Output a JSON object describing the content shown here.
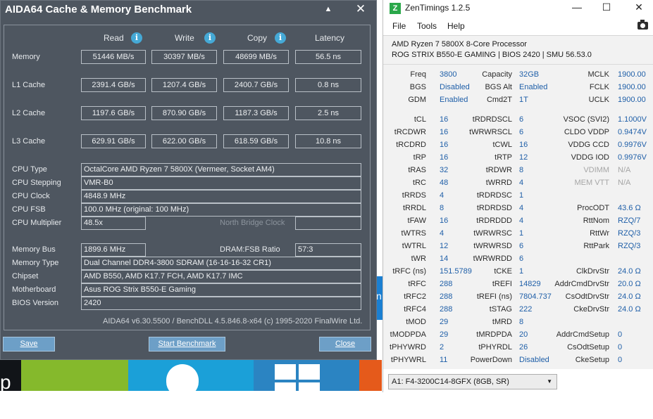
{
  "aida": {
    "title": "AIDA64 Cache & Memory Benchmark",
    "minimize": "▲",
    "close": "✕",
    "columns": [
      "Read",
      "Write",
      "Copy",
      "Latency"
    ],
    "info_glyph": "i",
    "bench_rows": [
      {
        "label": "Memory",
        "read": "51446 MB/s",
        "write": "30397 MB/s",
        "copy": "48699 MB/s",
        "latency": "56.5 ns"
      },
      {
        "label": "L1 Cache",
        "read": "2391.4 GB/s",
        "write": "1207.4 GB/s",
        "copy": "2400.7 GB/s",
        "latency": "0.8 ns"
      },
      {
        "label": "L2 Cache",
        "read": "1197.6 GB/s",
        "write": "870.90 GB/s",
        "copy": "1187.3 GB/s",
        "latency": "2.5 ns"
      },
      {
        "label": "L3 Cache",
        "read": "629.91 GB/s",
        "write": "622.00 GB/s",
        "copy": "618.59 GB/s",
        "latency": "10.8 ns"
      }
    ],
    "cpu": {
      "type_label": "CPU Type",
      "type": "OctalCore AMD Ryzen 7 5800X  (Vermeer, Socket AM4)",
      "stepping_label": "CPU Stepping",
      "stepping": "VMR-B0",
      "clock_label": "CPU Clock",
      "clock": "4848.9 MHz",
      "fsb_label": "CPU FSB",
      "fsb": "100.0 MHz  (original: 100 MHz)",
      "mult_label": "CPU Multiplier",
      "mult": "48.5x",
      "nb_label": "North Bridge Clock",
      "nb": ""
    },
    "mem": {
      "bus_label": "Memory Bus",
      "bus": "1899.6 MHz",
      "ratio_label": "DRAM:FSB Ratio",
      "ratio": "57:3",
      "type_label": "Memory Type",
      "type": "Dual Channel DDR4-3800 SDRAM  (16-16-16-32 CR1)",
      "chipset_label": "Chipset",
      "chipset": "AMD B550, AMD K17.7 FCH, AMD K17.7 IMC",
      "mobo_label": "Motherboard",
      "mobo": "Asus ROG Strix B550-E Gaming",
      "bios_label": "BIOS Version",
      "bios": "2420"
    },
    "footer": "AIDA64 v6.30.5500 / BenchDLL 4.5.846.8-x64  (c) 1995-2020 FinalWire Ltd.",
    "buttons": {
      "save": "Save",
      "start": "Start Benchmark",
      "close": "Close"
    }
  },
  "zen": {
    "logo": "Z",
    "title": "ZenTimings 1.2.5",
    "ctrl": {
      "min": "—",
      "max": "☐",
      "close": "✕"
    },
    "menu": [
      "File",
      "Tools",
      "Help"
    ],
    "cpu_name": "AMD Ryzen 7 5800X 8-Core Processor",
    "board": "ROG STRIX B550-E GAMING | BIOS 2420 | SMU 56.53.0",
    "top": [
      [
        [
          "Freq",
          "3800"
        ],
        [
          "Capacity",
          "32GB"
        ],
        [
          "MCLK",
          "1900.00"
        ]
      ],
      [
        [
          "BGS",
          "Disabled"
        ],
        [
          "BGS Alt",
          "Enabled"
        ],
        [
          "FCLK",
          "1900.00"
        ]
      ],
      [
        [
          "GDM",
          "Enabled"
        ],
        [
          "Cmd2T",
          "1T"
        ],
        [
          "UCLK",
          "1900.00"
        ]
      ]
    ],
    "timings": [
      [
        [
          "tCL",
          "16"
        ],
        [
          "tRDRDSCL",
          "6"
        ],
        [
          "VSOC (SVI2)",
          "1.1000V"
        ]
      ],
      [
        [
          "tRCDWR",
          "16"
        ],
        [
          "tWRWRSCL",
          "6"
        ],
        [
          "CLDO VDDP",
          "0.9474V"
        ]
      ],
      [
        [
          "tRCDRD",
          "16"
        ],
        [
          "tCWL",
          "16"
        ],
        [
          "VDDG CCD",
          "0.9976V"
        ]
      ],
      [
        [
          "tRP",
          "16"
        ],
        [
          "tRTP",
          "12"
        ],
        [
          "VDDG IOD",
          "0.9976V"
        ]
      ],
      [
        [
          "tRAS",
          "32"
        ],
        [
          "tRDWR",
          "8"
        ],
        [
          "VDIMM",
          "N/A"
        ]
      ],
      [
        [
          "tRC",
          "48"
        ],
        [
          "tWRRD",
          "4"
        ],
        [
          "MEM VTT",
          "N/A"
        ]
      ],
      [
        [
          "tRRDS",
          "4"
        ],
        [
          "tRDRDSC",
          "1"
        ],
        [
          "",
          ""
        ]
      ],
      [
        [
          "tRRDL",
          "8"
        ],
        [
          "tRDRDSD",
          "4"
        ],
        [
          "ProcODT",
          "43.6 Ω"
        ]
      ],
      [
        [
          "tFAW",
          "16"
        ],
        [
          "tRDRDDD",
          "4"
        ],
        [
          "RttNom",
          "RZQ/7"
        ]
      ],
      [
        [
          "tWTRS",
          "4"
        ],
        [
          "tWRWRSC",
          "1"
        ],
        [
          "RttWr",
          "RZQ/3"
        ]
      ],
      [
        [
          "tWTRL",
          "12"
        ],
        [
          "tWRWRSD",
          "6"
        ],
        [
          "RttPark",
          "RZQ/3"
        ]
      ],
      [
        [
          "tWR",
          "14"
        ],
        [
          "tWRWRDD",
          "6"
        ],
        [
          "",
          ""
        ]
      ],
      [
        [
          "tRFC (ns)",
          "151.5789"
        ],
        [
          "tCKE",
          "1"
        ],
        [
          "ClkDrvStr",
          "24.0 Ω"
        ]
      ],
      [
        [
          "tRFC",
          "288"
        ],
        [
          "tREFI",
          "14829"
        ],
        [
          "AddrCmdDrvStr",
          "20.0 Ω"
        ]
      ],
      [
        [
          "tRFC2",
          "288"
        ],
        [
          "tREFI (ns)",
          "7804.737"
        ],
        [
          "CsOdtDrvStr",
          "24.0 Ω"
        ]
      ],
      [
        [
          "tRFC4",
          "288"
        ],
        [
          "tSTAG",
          "222"
        ],
        [
          "CkeDrvStr",
          "24.0 Ω"
        ]
      ],
      [
        [
          "tMOD",
          "29"
        ],
        [
          "tMRD",
          "8"
        ],
        [
          "",
          ""
        ]
      ],
      [
        [
          "tMODPDA",
          "29"
        ],
        [
          "tMRDPDA",
          "20"
        ],
        [
          "AddrCmdSetup",
          "0"
        ]
      ],
      [
        [
          "tPHYWRD",
          "2"
        ],
        [
          "tPHYRDL",
          "26"
        ],
        [
          "CsOdtSetup",
          "0"
        ]
      ],
      [
        [
          "tPHYWRL",
          "11"
        ],
        [
          "PowerDown",
          "Disabled"
        ],
        [
          "CkeSetup",
          "0"
        ]
      ]
    ],
    "module_select": "A1: F4-3200C14-8GFX (8GB, SR)",
    "module_arrow": "▼"
  },
  "desktop": {
    "tile_letter": "p",
    "edge_letter": "n"
  },
  "colors": {
    "aida_bg": "#4e5660",
    "zen_value": "#1f5fa8",
    "button": "#6d9fc7"
  }
}
